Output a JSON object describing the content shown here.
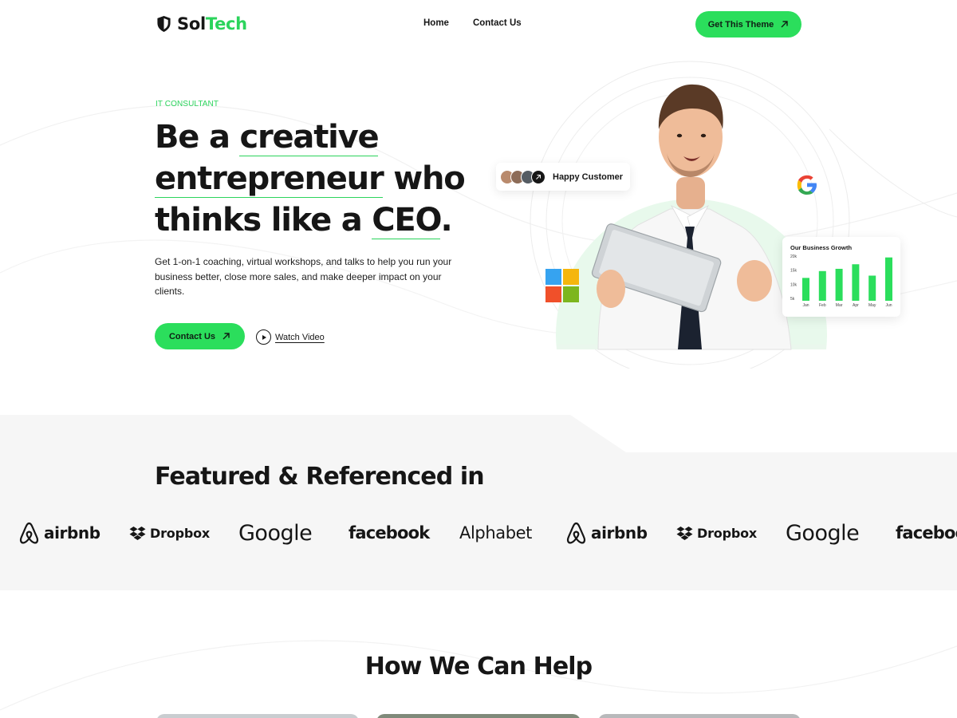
{
  "header": {
    "brand_part1": "Sol",
    "brand_part2": "Tech",
    "nav": [
      "Home",
      "Contact Us"
    ],
    "cta_label": "Get This Theme"
  },
  "hero": {
    "kicker": "IT CONSULTANT",
    "headline": {
      "w1": "Be a ",
      "w2": "creative",
      "w3": "entrepreneur",
      "w4": " who",
      "w5": "thinks like a ",
      "w6": "CEO",
      "w7": "."
    },
    "description": "Get 1-on-1 coaching, virtual workshops, and talks to help you run your business better, close more sales, and make deeper impact on your clients.",
    "primary_cta": "Contact Us",
    "secondary_cta": "Watch Video",
    "badge_label": "Happy Customer",
    "accent_color": "#2bde5c"
  },
  "growth_card": {
    "title": "Our Business Growth",
    "y_ticks": [
      "20k",
      "15k",
      "10k",
      "5k"
    ],
    "months": [
      "Jan",
      "Feb",
      "Mar",
      "Apr",
      "May",
      "Jun"
    ],
    "values": [
      9,
      12,
      13,
      15,
      10,
      18
    ]
  },
  "featured": {
    "title": "Featured & Referenced in",
    "brands": [
      "airbnb",
      "Dropbox",
      "Google",
      "facebook",
      "Alphabet",
      "airbnb",
      "Dropbox",
      "Google",
      "faceboo"
    ]
  },
  "help": {
    "title": "How We Can Help"
  }
}
